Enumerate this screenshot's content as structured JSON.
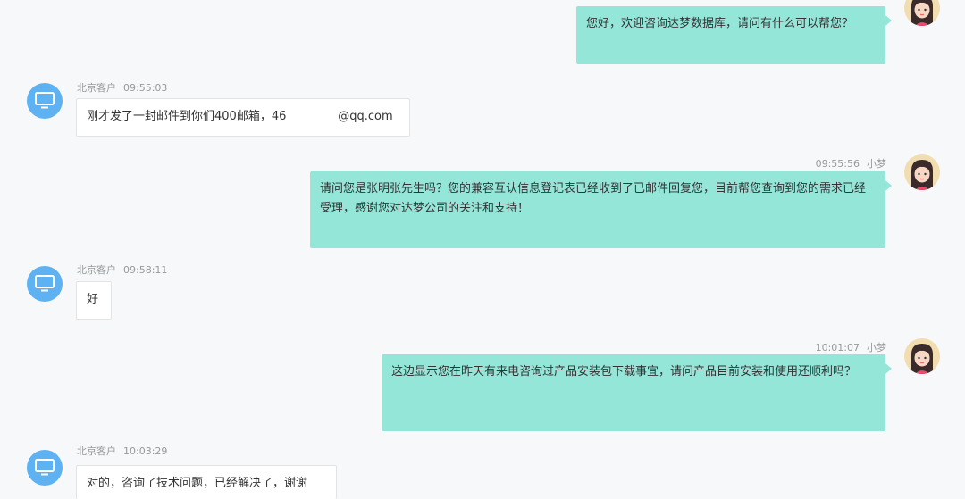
{
  "messages": [
    {
      "side": "agent",
      "name": "",
      "time": "",
      "text": "您好，欢迎咨询达梦数据库，请问有什么可以帮您？"
    },
    {
      "side": "customer",
      "name": "北京客户",
      "time": "09:55:03",
      "text": "刚才发了一封邮件到你们400邮箱，46       @qq.com"
    },
    {
      "side": "agent",
      "name": "小梦",
      "time": "09:55:56",
      "text": "请问您是张明张先生吗？您的兼容互认信息登记表已经收到了已邮件回复您，目前帮您查询到您的需求已经受理，感谢您对达梦公司的关注和支持！"
    },
    {
      "side": "customer",
      "name": "北京客户",
      "time": "09:58:11",
      "text": "好"
    },
    {
      "side": "agent",
      "name": "小梦",
      "time": "10:01:07",
      "text": "这边显示您在昨天有来电咨询过产品安装包下载事宜，请问产品目前安装和使用还顺利吗？"
    },
    {
      "side": "customer",
      "name": "北京客户",
      "time": "10:03:29",
      "text": "对的，咨询了技术问题，已经解决了，谢谢"
    }
  ],
  "icons": {
    "customer_avatar": "monitor-icon",
    "agent_avatar": "girl-avatar-icon"
  },
  "colors": {
    "agent_bubble": "#94e6d9",
    "customer_avatar": "#5eb2f2",
    "background": "#f7f8fa"
  }
}
